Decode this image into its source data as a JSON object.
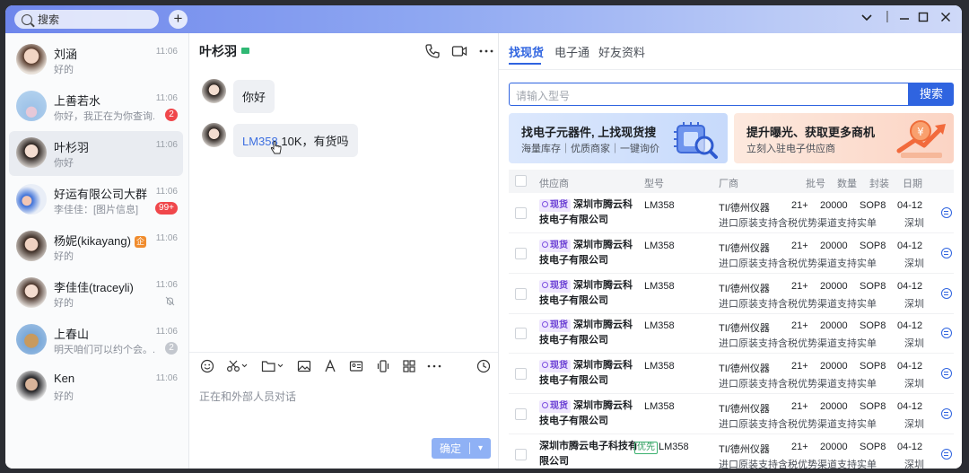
{
  "titlebar": {
    "search_placeholder": "搜索",
    "add_label": "+"
  },
  "contacts": [
    {
      "name": "刘涵",
      "preview": "好的",
      "time": "11:06",
      "badge": "",
      "active": false
    },
    {
      "name": "上善若水",
      "preview": "你好，我正在为你查询...",
      "time": "11:06",
      "badge": "2",
      "active": false
    },
    {
      "name": "叶杉羽",
      "preview": "你好",
      "time": "11:06",
      "badge": "",
      "active": true
    },
    {
      "name": "好运有限公司大群",
      "preview": "李佳佳：[图片信息]",
      "time": "11:06",
      "badge": "99+",
      "active": false
    },
    {
      "name": "杨妮(kikayang)",
      "preview": "好的",
      "time": "11:06",
      "badge": "",
      "active": false
    },
    {
      "name": "李佳佳(traceyli)",
      "preview": "好的",
      "time": "11:06",
      "badge": "",
      "active": false
    },
    {
      "name": "上春山",
      "preview": "明天咱们可以约个会。...",
      "time": "11:06",
      "badge": "2",
      "active": false
    },
    {
      "name": "Ken",
      "preview": "好的",
      "time": "11:06",
      "badge": "",
      "active": false
    }
  ],
  "contact_org_tag": "企",
  "chat": {
    "title": "叶杉羽",
    "messages": [
      {
        "text": "你好"
      },
      {
        "link": "LM358",
        "text": " 10K，有货吗"
      }
    ],
    "input_placeholder": "正在和外部人员对话",
    "send_label": "确定",
    "send_chevron": "▾"
  },
  "panel": {
    "tabs": [
      "找现货",
      "电子通",
      "好友资料"
    ],
    "search_placeholder": "请输入型号",
    "search_button": "搜索",
    "banner1": {
      "title": "找电子元器件, 上找现货搜",
      "subtitle": "海量库存｜优质商家｜一键询价"
    },
    "banner2": {
      "title": "提升曝光、获取更多商机",
      "subtitle": "立刻入驻电子供应商"
    },
    "columns": [
      "供应商",
      "型号",
      "厂商",
      "批号",
      "数量",
      "封装",
      "日期"
    ],
    "rows": [
      {
        "tag": "现货",
        "supplier_line1": "深圳市腾云科",
        "supplier_line2": "技电子有限公司",
        "model": "LM358",
        "maker": "TI/德州仪器",
        "batch": "21+",
        "qty": "20000",
        "pkg": "SOP8",
        "date": "04-12",
        "city": "深圳",
        "note": "进口原装支持含税优势渠道支持实单"
      },
      {
        "tag": "现货",
        "supplier_line1": "深圳市腾云科",
        "supplier_line2": "技电子有限公司",
        "model": "LM358",
        "maker": "TI/德州仪器",
        "batch": "21+",
        "qty": "20000",
        "pkg": "SOP8",
        "date": "04-12",
        "city": "深圳",
        "note": "进口原装支持含税优势渠道支持实单"
      },
      {
        "tag": "现货",
        "supplier_line1": "深圳市腾云科",
        "supplier_line2": "技电子有限公司",
        "model": "LM358",
        "maker": "TI/德州仪器",
        "batch": "21+",
        "qty": "20000",
        "pkg": "SOP8",
        "date": "04-12",
        "city": "深圳",
        "note": "进口原装支持含税优势渠道支持实单"
      },
      {
        "tag": "现货",
        "supplier_line1": "深圳市腾云科",
        "supplier_line2": "技电子有限公司",
        "model": "LM358",
        "maker": "TI/德州仪器",
        "batch": "21+",
        "qty": "20000",
        "pkg": "SOP8",
        "date": "04-12",
        "city": "深圳",
        "note": "进口原装支持含税优势渠道支持实单"
      },
      {
        "tag": "现货",
        "supplier_line1": "深圳市腾云科",
        "supplier_line2": "技电子有限公司",
        "model": "LM358",
        "maker": "TI/德州仪器",
        "batch": "21+",
        "qty": "20000",
        "pkg": "SOP8",
        "date": "04-12",
        "city": "深圳",
        "note": "进口原装支持含税优势渠道支持实单"
      },
      {
        "tag": "现货",
        "supplier_line1": "深圳市腾云科",
        "supplier_line2": "技电子有限公司",
        "model": "LM358",
        "maker": "TI/德州仪器",
        "batch": "21+",
        "qty": "20000",
        "pkg": "SOP8",
        "date": "04-12",
        "city": "深圳",
        "note": "进口原装支持含税优势渠道支持实单"
      },
      {
        "tag": "",
        "supplier_line1": "深圳市腾云电子科技有",
        "supplier_line2": "限公司",
        "priority_tag": "优先",
        "model": "LM358",
        "maker": "TI/德州仪器",
        "batch": "21+",
        "qty": "20000",
        "pkg": "SOP8",
        "date": "04-12",
        "city": "深圳",
        "note": "进口原装支持含税优势渠道支持实单"
      }
    ]
  },
  "colors": {
    "accent": "#2f64e0",
    "badge": "#f0474b",
    "spot_tag": "#6a3fd4"
  }
}
